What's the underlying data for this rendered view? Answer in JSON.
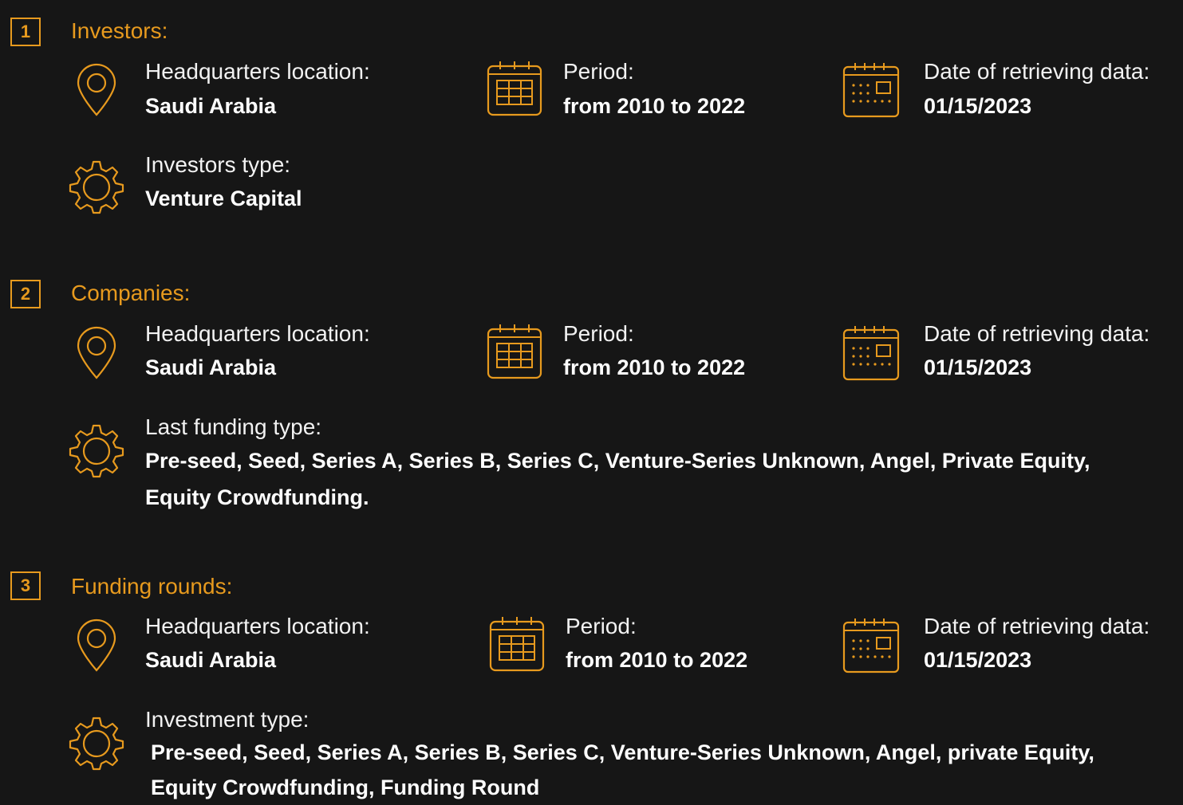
{
  "sections": [
    {
      "number": "1",
      "title": "Investors:",
      "location_label": "Headquarters location:",
      "location_value": "Saudi Arabia",
      "period_label": "Period:",
      "period_value": "from 2010 to 2022",
      "date_label": "Date of retrieving data:",
      "date_value": "01/15/2023",
      "type_label": "Investors type:",
      "type_value": "Venture Capital"
    },
    {
      "number": "2",
      "title": "Companies:",
      "location_label": "Headquarters location:",
      "location_value": "Saudi Arabia",
      "period_label": "Period:",
      "period_value": "from 2010 to 2022",
      "date_label": "Date of retrieving data:",
      "date_value": "01/15/2023",
      "type_label": "Last funding type:",
      "type_value": "Pre-seed, Seed, Series A, Series B, Series C, Venture-Series Unknown, Angel, Private Equity, Equity Crowdfunding."
    },
    {
      "number": "3",
      "title": "Funding rounds:",
      "location_label": "Headquarters location:",
      "location_value": "Saudi Arabia",
      "period_label": "Period:",
      "period_value": "from 2010 to 2022",
      "date_label": "Date of retrieving data:",
      "date_value": "01/15/2023",
      "type_label": "Investment type:",
      "type_value": "Pre-seed, Seed, Series A, Series B, Series C, Venture-Series Unknown, Angel, private Equity, Equity Crowdfunding, Funding Round"
    }
  ],
  "icons": {
    "location": "map-pin-icon",
    "period": "calendar-grid-icon",
    "date": "calendar-dots-icon",
    "type": "gear-icon"
  },
  "colors": {
    "accent": "#e79a1e",
    "background": "#161616",
    "text": "#ffffff"
  }
}
